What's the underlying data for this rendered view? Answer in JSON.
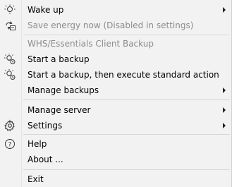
{
  "menu": {
    "wake_up": "Wake up",
    "save_energy": "Save energy now (Disabled in settings)",
    "section_header": "WHS/Essentials Client Backup",
    "start_backup": "Start a backup",
    "start_backup_then": "Start a backup, then execute standard action",
    "manage_backups": "Manage backups",
    "manage_server": "Manage server",
    "settings": "Settings",
    "help": "Help",
    "about": "About ...",
    "exit": "Exit"
  },
  "icons": {
    "wake_up": "lightbulb-icon",
    "save_energy": "power-saving-icon",
    "start_backup": "backup-bulb-icon",
    "start_backup_then": "backup-bulb-icon",
    "settings": "gear-icon",
    "help": "question-circle-icon"
  }
}
